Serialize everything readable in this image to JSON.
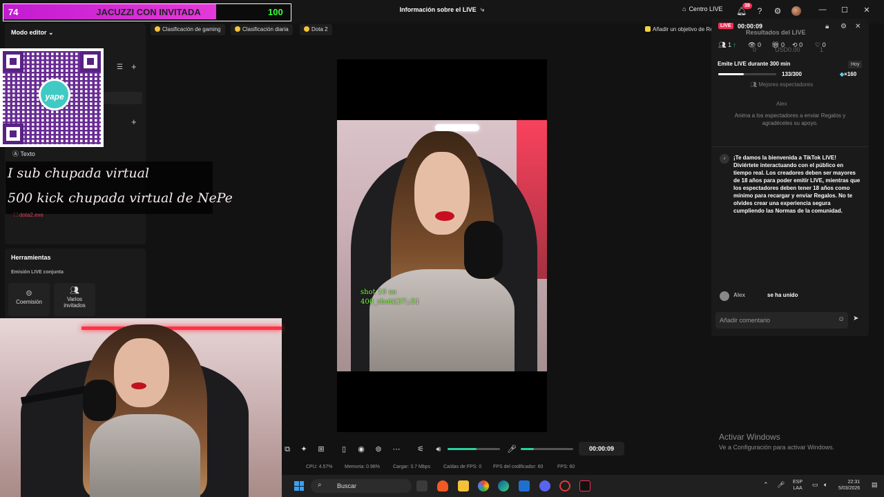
{
  "titlebar": {
    "title": "Información sobre el LIVE",
    "centro_live": "Centro LIVE",
    "notif_count": "39"
  },
  "goal": {
    "left_number": "74",
    "title": "JACUZZI CON INVITADA",
    "right_number": "100",
    "progress": 0.74
  },
  "chips": {
    "gaming": "Clasificación de gaming",
    "diaria": "Clasificación diaria",
    "dota": "Dota 2",
    "objetivo": "Añadir un objetivo de Re"
  },
  "left": {
    "modo_editor": "Modo editor",
    "texto": "Texto",
    "overlay_line1": "I sub chupada virtual",
    "overlay_line2": "500 kick chupada virtual de NePe",
    "dota_exe": "dota2.exe",
    "herramientas": "Herramientas",
    "emision": "Emisión LIVE conjunta",
    "coemision": "Coemisión",
    "varios": "Varios",
    "invitados": "invitados",
    "yape": "yape"
  },
  "preview": {
    "shot1": "shot 10 so",
    "shot2": "400_shot((37;;51"
  },
  "controls": {
    "timer": "00:00:09",
    "volume_level": 0.55,
    "mic_level": 0.25
  },
  "stats": {
    "cpu": "CPU: 4.57%",
    "memoria": "Memoria: 0.98%",
    "cargar": "Cargar: 3.7 Mbps",
    "caidas": "Caídas de FPS: 0",
    "fps_codificador": "FPS del codificador: 60",
    "fps": "FPS: 60"
  },
  "right": {
    "live_badge": "LIVE",
    "time": "00:00:09",
    "resultados": "Resultados del LIVE",
    "stat_viewers": "1",
    "stat_views": "0",
    "stat_gifts": "0",
    "stat_shares": "0",
    "stat_likes": "0",
    "bg_usd": "USD0.00",
    "bg_1": "1",
    "bg_0": "0",
    "emite": "Emite LIVE durante 300 min",
    "hoy": "Hoy",
    "progress_text": "133/300",
    "progress": 0.443,
    "gems": "×160",
    "mejores": "Mejores espectadores",
    "alex": "Alex",
    "anima": "Anima a los espectadores a enviar Regalos y agradéceles su apoyo.",
    "welcome": "¡Te damos la bienvenida a TikTok LIVE! Diviértete interactuando con el público en tiempo real. Los creadores deben ser mayores de 18 años para poder emitir LIVE, mientras que los espectadores deben tener 18 años como mínimo para recargar y enviar Regalos. No te olvides crear una experiencia segura cumpliendo las Normas de la comunidad.",
    "joined_name": "Alex",
    "joined_text": "se ha unido",
    "comment_placeholder": "Añadir comentario"
  },
  "watermark": {
    "line1": "Activar Windows",
    "line2": "Ve a Configuración para activar Windows."
  },
  "taskbar": {
    "search": "Buscar",
    "lang1": "ESP",
    "lang2": "LAA",
    "time": "22:31",
    "date": "5/03/2026"
  }
}
